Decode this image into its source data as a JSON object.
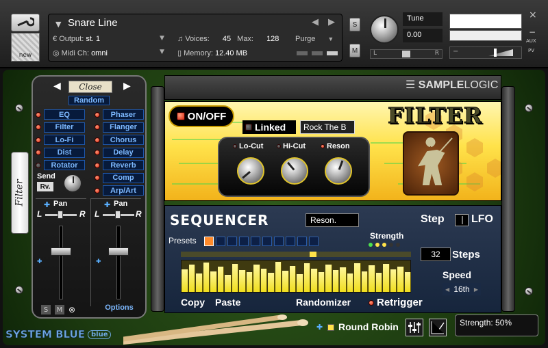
{
  "header": {
    "instrument_name": "Snare Line",
    "output_label": "Output:",
    "output_value": "st. 1",
    "voices_label": "Voices:",
    "voices_value": "45",
    "max_label": "Max:",
    "max_value": "128",
    "purge_label": "Purge",
    "midi_label": "Midi Ch:",
    "midi_value": "omni",
    "memory_label": "Memory:",
    "memory_value": "12.40 MB",
    "new_label": "new",
    "s_label": "S",
    "m_label": "M",
    "tune_label": "Tune",
    "tune_value": "0.00",
    "l_label": "L",
    "r_label": "R",
    "aux_label": "AUX",
    "pv_label": "PV",
    "close_x": "×",
    "minus": "−"
  },
  "left_panel": {
    "close_label": "Close",
    "random_label": "Random",
    "effects_left": [
      "EQ",
      "Filter",
      "Lo-Fi",
      "Dist",
      "Rotator"
    ],
    "effects_right": [
      "Phaser",
      "Flanger",
      "Chorus",
      "Delay",
      "Reverb",
      "Comp",
      "Arp/Art"
    ],
    "send_label": "Send",
    "send_value": "Rv.",
    "pan_label": "Pan",
    "l": "L",
    "r": "R",
    "s": "S",
    "m": "M",
    "options_label": "Options",
    "vertical_tab": "Filter"
  },
  "brand": {
    "logo_text": "SAMPLELOGIC",
    "brand_bold": "SAMPLE",
    "brand_light": "LOGIC",
    "product_name": "SYSTEM BLUE",
    "product_badge": "blue"
  },
  "filter": {
    "onoff_label": "ON/OFF",
    "linked_label": "Linked",
    "preset_value": "Rock The B",
    "title": "FILTER",
    "knobs": [
      "Lo-Cut",
      "Hi-Cut",
      "Reson"
    ]
  },
  "sequencer": {
    "title": "SEQUENCER",
    "target_value": "Reson.",
    "step_label": "Step",
    "lfo_label": "LFO",
    "presets_label": "Presets",
    "strength_label": "Strength",
    "steps_value": "32",
    "steps_label": "Steps",
    "speed_label": "Speed",
    "speed_value": "16th",
    "copy_label": "Copy",
    "paste_label": "Paste",
    "randomizer_label": "Randomizer",
    "retrigger_label": "Retrigger",
    "bar_values": [
      0.72,
      0.86,
      0.58,
      0.93,
      0.65,
      0.8,
      0.55,
      0.9,
      0.7,
      0.62,
      0.88,
      0.75,
      0.6,
      0.95,
      0.68,
      0.82,
      0.57,
      0.91,
      0.73,
      0.64,
      0.87,
      0.69,
      0.78,
      0.59,
      0.92,
      0.66,
      0.84,
      0.61,
      0.89,
      0.71,
      0.8,
      0.63
    ]
  },
  "footer": {
    "round_robin_label": "Round Robin",
    "strength_status": "Strength: 50%"
  }
}
